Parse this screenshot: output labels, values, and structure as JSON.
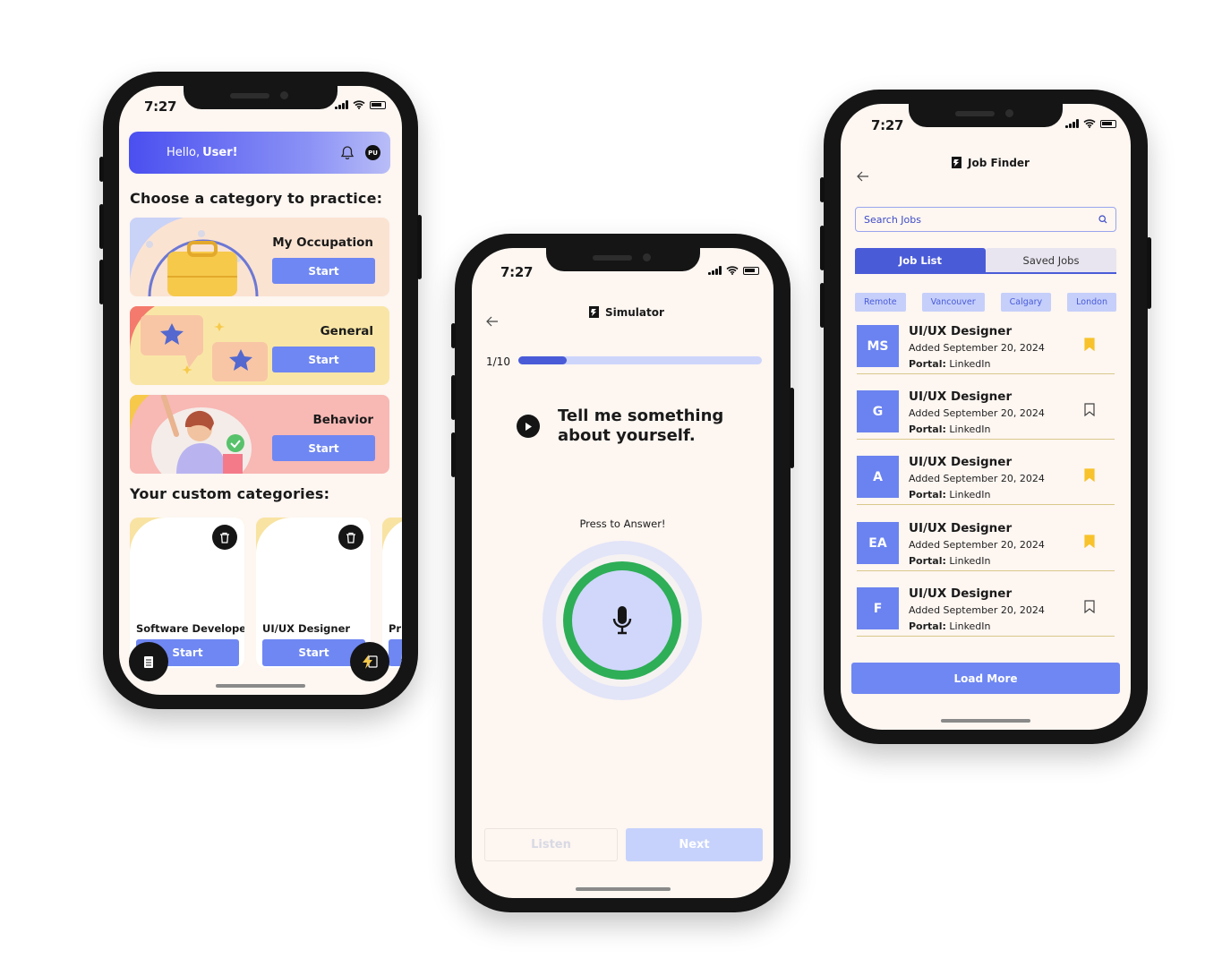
{
  "status_time": "7:27",
  "phone1": {
    "greeting": "Hello,",
    "user": "User!",
    "avatar_initials": "PU",
    "choose_heading": "Choose a category to practice:",
    "categories": [
      {
        "title": "My Occupation",
        "button": "Start"
      },
      {
        "title": "General",
        "button": "Start"
      },
      {
        "title": "Behavior",
        "button": "Start"
      }
    ],
    "custom_heading": "Your custom categories:",
    "custom_categories": [
      {
        "title": "Software Developer",
        "button": "Start"
      },
      {
        "title": "UI/UX Designer",
        "button": "Start"
      },
      {
        "title": "Pr",
        "button": ""
      }
    ]
  },
  "phone2": {
    "app_title": "Simulator",
    "progress_label": "1/10",
    "progress_fraction": 0.2,
    "question": "Tell me something about yourself.",
    "press_label": "Press to Answer!",
    "listen_button": "Listen",
    "next_button": "Next",
    "colors": {
      "accent": "#4a5bd8",
      "record_ring": "#2eae57"
    }
  },
  "phone3": {
    "app_title": "Job Finder",
    "search_placeholder": "Search Jobs",
    "tabs": [
      "Job List",
      "Saved Jobs"
    ],
    "filters": [
      "Remote",
      "Vancouver",
      "Calgary",
      "London"
    ],
    "portal_label": "Portal:",
    "jobs": [
      {
        "logo": "MS",
        "title": "UI/UX Designer",
        "date": "Added September 20, 2024",
        "portal": "LinkedIn",
        "saved": true
      },
      {
        "logo": "G",
        "title": "UI/UX Designer",
        "date": "Added September 20, 2024",
        "portal": "LinkedIn",
        "saved": false
      },
      {
        "logo": "A",
        "title": "UI/UX Designer",
        "date": "Added September 20, 2024",
        "portal": "LinkedIn",
        "saved": true
      },
      {
        "logo": "EA",
        "title": "UI/UX Designer",
        "date": "Added September 20, 2024",
        "portal": "LinkedIn",
        "saved": true
      },
      {
        "logo": "F",
        "title": "UI/UX Designer",
        "date": "Added September 20, 2024",
        "portal": "LinkedIn",
        "saved": false
      }
    ],
    "load_more": "Load More",
    "colors": {
      "saved_bookmark": "#f7c22b",
      "logo_bg": "#6b83f0"
    }
  }
}
